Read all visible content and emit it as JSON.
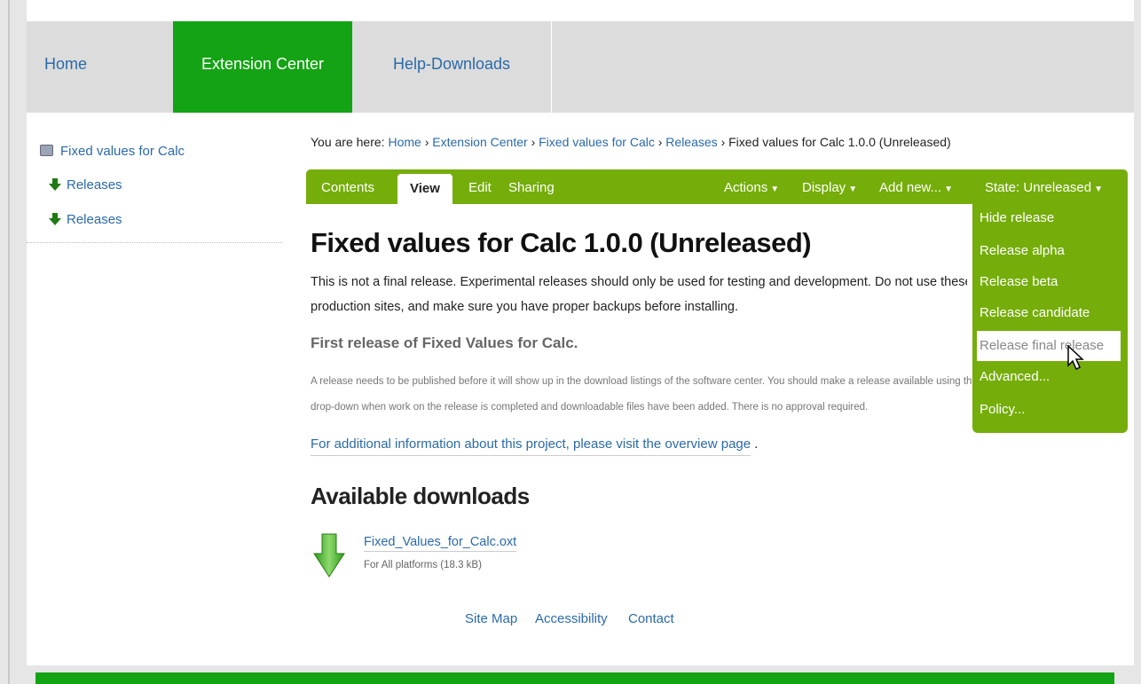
{
  "nav": {
    "items": [
      "Home",
      "Extension Center",
      "Help-Downloads"
    ],
    "active": "Extension Center"
  },
  "sidebar": {
    "title": "Fixed values for Calc",
    "items": [
      "Releases",
      "Releases"
    ]
  },
  "breadcrumb": {
    "prefix": "You are here:",
    "links": [
      "Home",
      "Extension Center",
      "Fixed values for Calc",
      "Releases"
    ],
    "current": "Fixed values for Calc 1.0.0 (Unreleased)",
    "separator": "›"
  },
  "editbar": {
    "tabs": [
      "Contents",
      "View",
      "Edit",
      "Sharing"
    ],
    "menus": [
      "Actions",
      "Display",
      "Add new...",
      "State: Unreleased"
    ]
  },
  "state_menu": {
    "items": [
      "Hide release",
      "Release alpha",
      "Release beta",
      "Release candidate",
      "Release final release",
      "Advanced...",
      "Policy..."
    ],
    "highlighted": "Release final release"
  },
  "content": {
    "title": "Fixed values for Calc 1.0.0 (Unreleased)",
    "warning_line1": "This is not a final release. Experimental releases should only be used for testing and development. Do not use these on",
    "warning_line2": "production sites, and make sure you have proper backups before installing.",
    "description": "First release of Fixed Values for Calc.",
    "note_line1": "A release needs to be published before it will show up in the download listings of the software center. You should make a release available using the state",
    "note_line2": "drop-down when work on the release is completed and downloadable files have been added. There is no approval required.",
    "info_link": "For additional information about this project, please visit the overview page",
    "info_end": ".",
    "downloads_heading": "Available downloads",
    "file_name": "Fixed_Values_for_Calc.oxt",
    "file_meta": "For All platforms (18.3 kB)"
  },
  "footer": [
    "Site Map",
    "Accessibility",
    "Contact"
  ],
  "colors": {
    "brand_green": "#14a314",
    "edit_green": "#75ad0a",
    "link_blue": "#2b6aa8"
  }
}
